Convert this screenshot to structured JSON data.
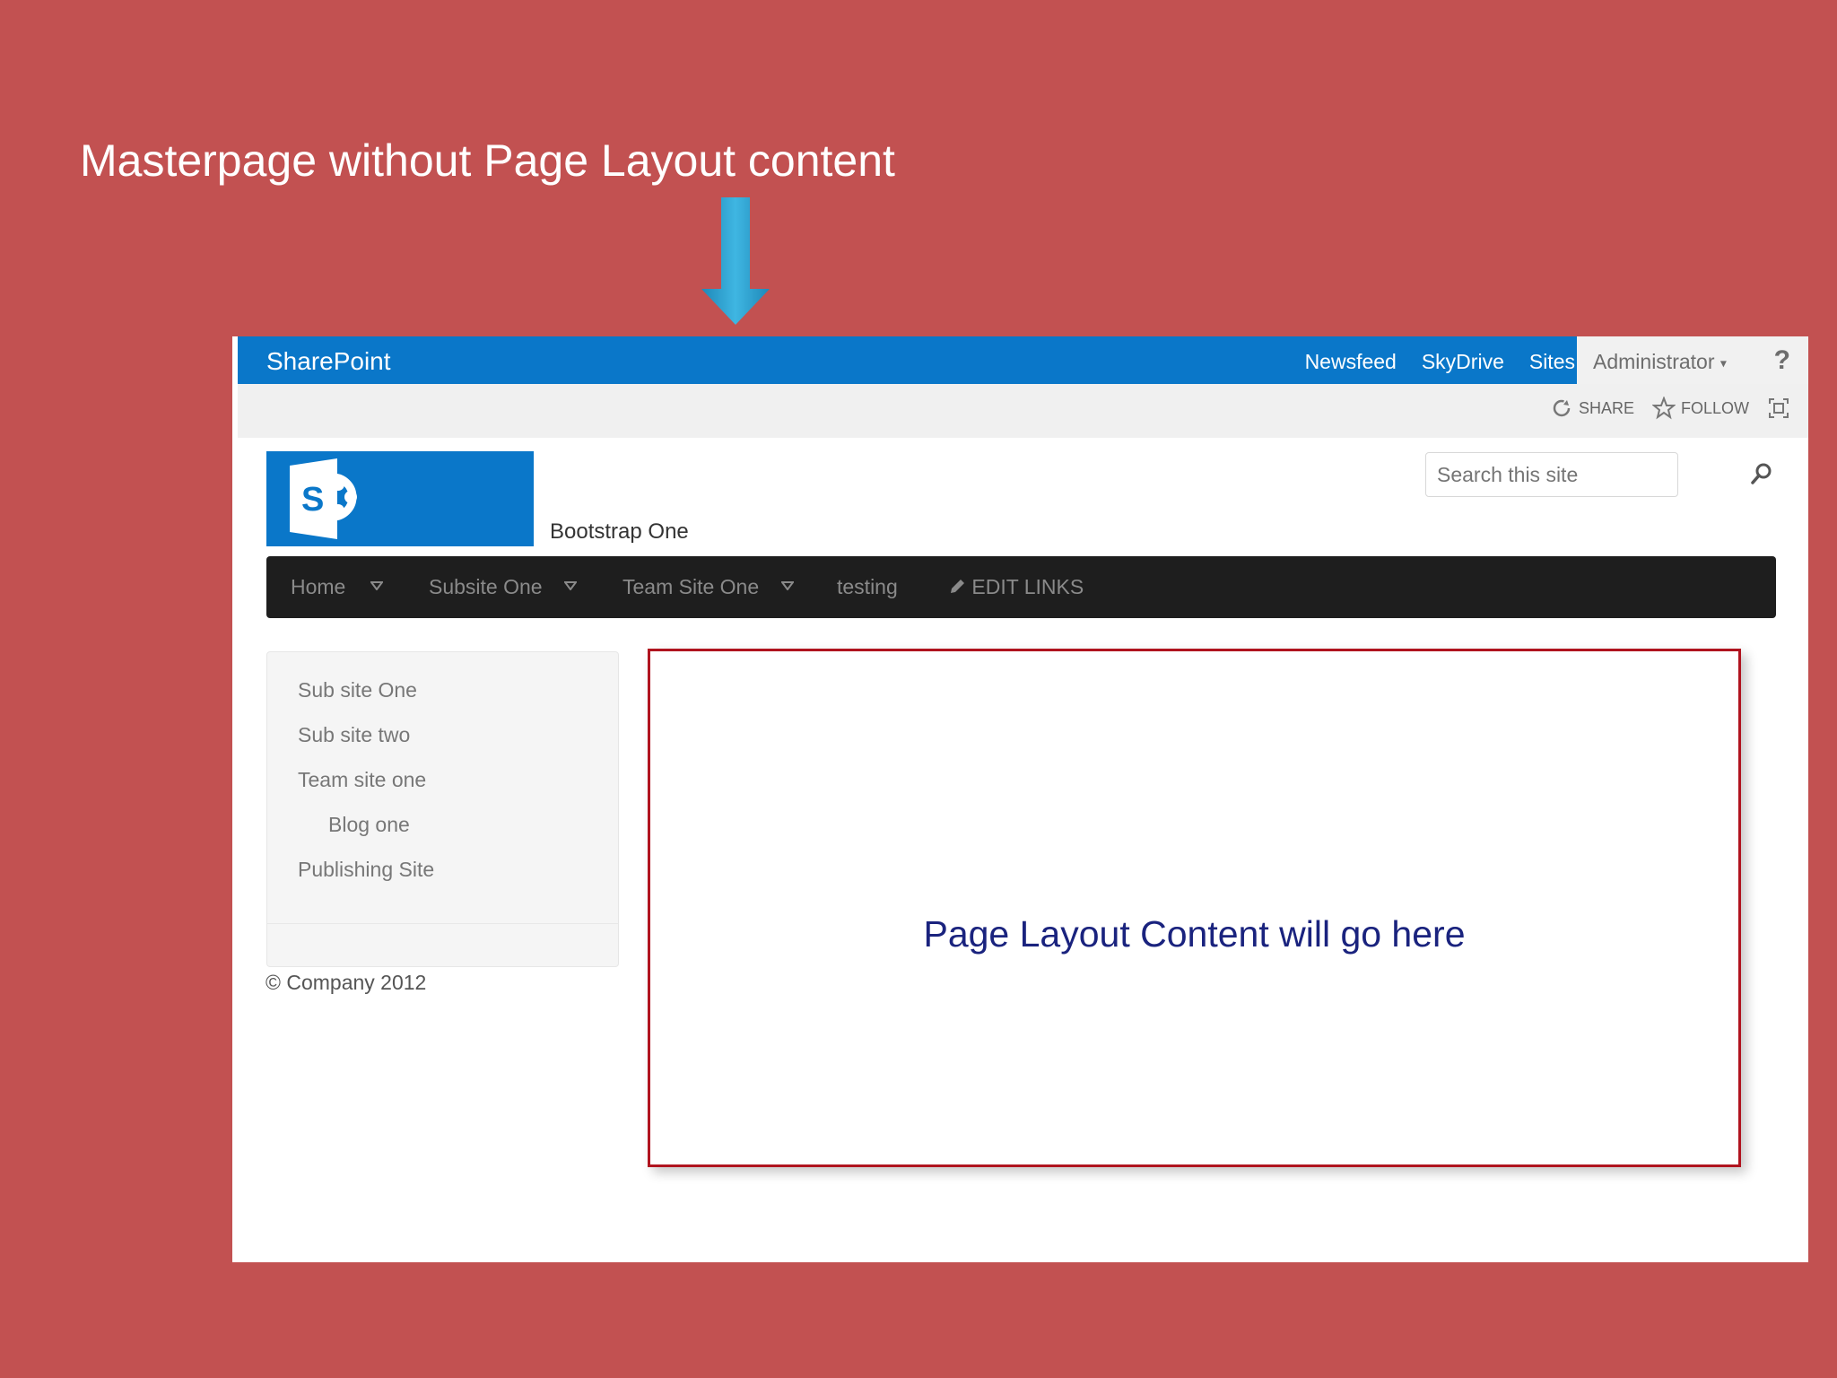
{
  "slide": {
    "title": "Masterpage without Page Layout content"
  },
  "suitebar": {
    "brand": "SharePoint",
    "links": [
      "Newsfeed",
      "SkyDrive",
      "Sites"
    ],
    "user": "Administrator",
    "help": "?"
  },
  "ribbon": {
    "share": "SHARE",
    "follow": "FOLLOW"
  },
  "site": {
    "title": "Bootstrap One",
    "search_placeholder": "Search this site"
  },
  "topnav": {
    "items": [
      "Home",
      "Subsite One",
      "Team Site One",
      "testing"
    ],
    "edit_links": "EDIT LINKS"
  },
  "sidebar": {
    "items": [
      "Sub site One",
      "Sub site two",
      "Team site one",
      "Blog one",
      "Publishing Site"
    ]
  },
  "footer": {
    "copyright": "© Company 2012"
  },
  "content": {
    "placeholder": "Page Layout Content will go here"
  },
  "colors": {
    "slide_background": "#c25151",
    "suitebar": "#0a77c9",
    "topnav": "#1e1e1e",
    "content_border": "#b0141f",
    "content_text": "#1a237e"
  }
}
